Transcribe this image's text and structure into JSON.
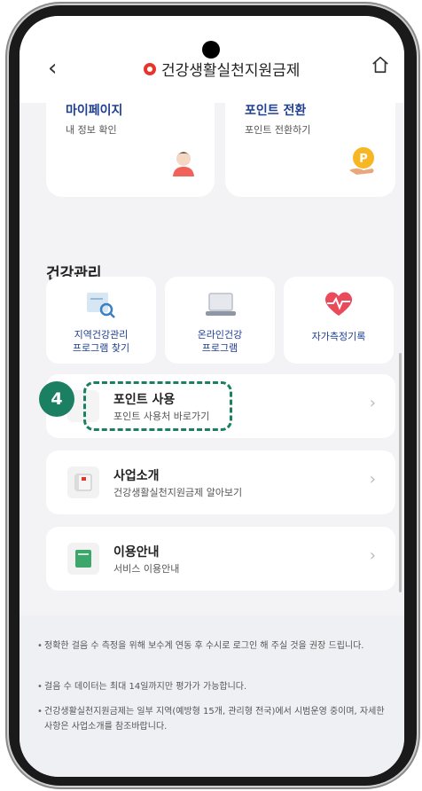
{
  "header": {
    "title": "건강생활실천지원금제"
  },
  "cards": [
    {
      "title": "마이페이지",
      "subtitle": "내 정보 확인"
    },
    {
      "title": "포인트 전환",
      "subtitle": "포인트 전환하기"
    }
  ],
  "health": {
    "section_title": "건강관리",
    "tiles": [
      {
        "label_line1": "지역건강관리",
        "label_line2": "프로그램 찾기"
      },
      {
        "label_line1": "온라인건강",
        "label_line2": "프로그램"
      },
      {
        "label_line1": "자가측정기록",
        "label_line2": ""
      }
    ]
  },
  "rows": [
    {
      "title": "포인트 사용",
      "subtitle": "포인트 사용처 바로가기"
    },
    {
      "title": "사업소개",
      "subtitle": "건강생활실천지원금제 알아보기"
    },
    {
      "title": "이용안내",
      "subtitle": "서비스 이용안내"
    }
  ],
  "step_badge": "4",
  "notes": [
    "정확한 걸음 수 측정을 위해 보수계 연동 후 수시로 로그인 해 주실 것을 권장 드립니다.",
    "걸음 수 데이터는 최대 14일까지만 평가가 가능합니다.",
    "건강생활실천지원금제는 일부 지역(예방형 15개, 관리형 전국)에서 시범운영 중이며, 자세한 사항은 사업소개를 참조바랍니다."
  ],
  "colors": {
    "accent_blue": "#1f3f92",
    "step_green": "#1b7f62",
    "logo_red": "#e8352c"
  }
}
